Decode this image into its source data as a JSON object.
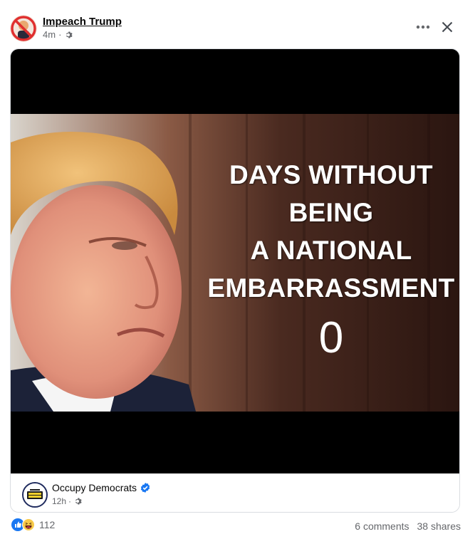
{
  "post": {
    "page_name": "Impeach Trump",
    "time": "4m",
    "separator": "·"
  },
  "meme": {
    "lines": [
      "DAYS WITHOUT",
      "BEING",
      "A NATIONAL",
      "EMBARRASSMENT"
    ],
    "count": "0"
  },
  "shared_source": {
    "name": "Occupy Democrats",
    "time": "12h",
    "separator": "·",
    "verified": true
  },
  "footer": {
    "reaction_count": "112",
    "comments": "6 comments",
    "shares": "38 shares"
  },
  "colors": {
    "accent": "#1877f2",
    "muted": "#65676b",
    "avatar_red": "#e02f2f"
  },
  "icons": [
    "gear-icon",
    "more-icon",
    "close-icon",
    "verified-icon",
    "like-reaction-icon",
    "haha-reaction-icon"
  ]
}
